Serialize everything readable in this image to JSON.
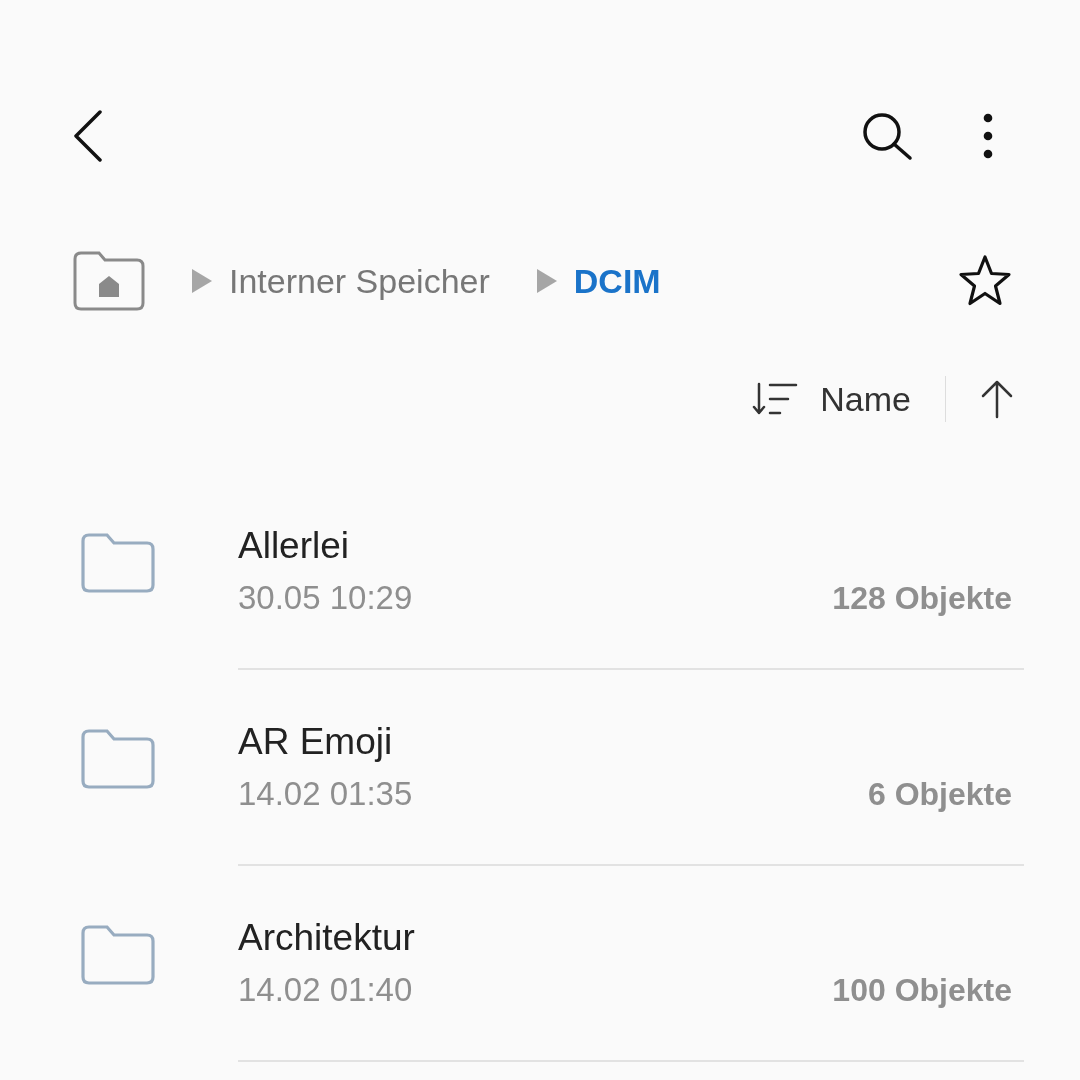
{
  "breadcrumb": [
    {
      "label": "Interner Speicher",
      "current": false
    },
    {
      "label": "DCIM",
      "current": true
    }
  ],
  "sort": {
    "label": "Name"
  },
  "folders": [
    {
      "name": "Allerlei",
      "date": "30.05 10:29",
      "count": "128 Objekte"
    },
    {
      "name": "AR Emoji",
      "date": "14.02 01:35",
      "count": "6 Objekte"
    },
    {
      "name": "Architektur",
      "date": "14.02 01:40",
      "count": "100 Objekte"
    }
  ]
}
